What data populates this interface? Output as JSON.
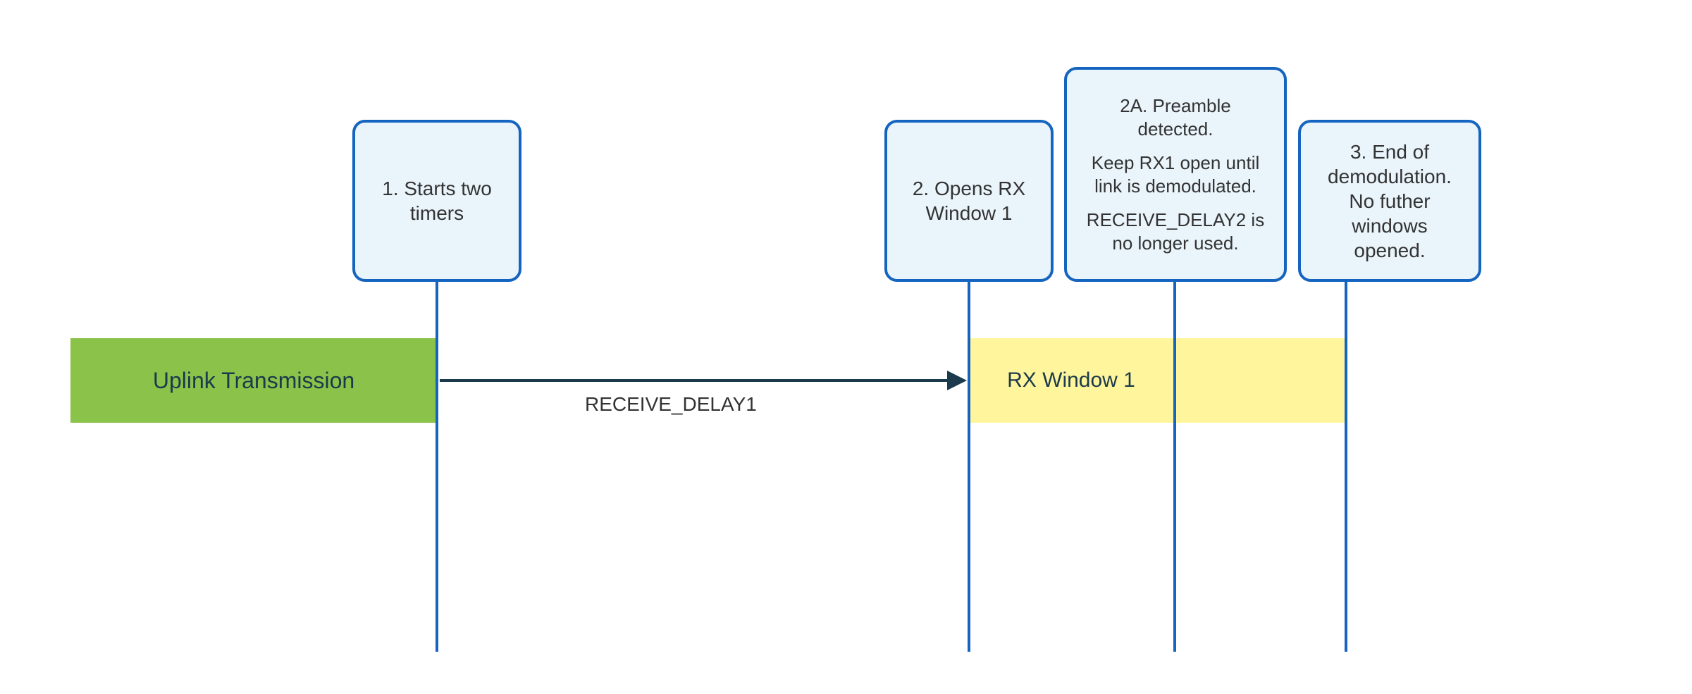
{
  "uplink": {
    "label": "Uplink Transmission"
  },
  "rx_window": {
    "label": "RX Window 1"
  },
  "arrow": {
    "label": "RECEIVE_DELAY1"
  },
  "callouts": {
    "c1": {
      "text": "1. Starts two timers"
    },
    "c2": {
      "text": "2. Opens RX Window 1"
    },
    "c2a": {
      "p1": "2A. Preamble detected.",
      "p2": "Keep RX1 open until link is demodulated.",
      "p3": "RECEIVE_DELAY2 is no longer used."
    },
    "c3": {
      "text": "3. End of demodulation. No futher windows opened."
    }
  }
}
